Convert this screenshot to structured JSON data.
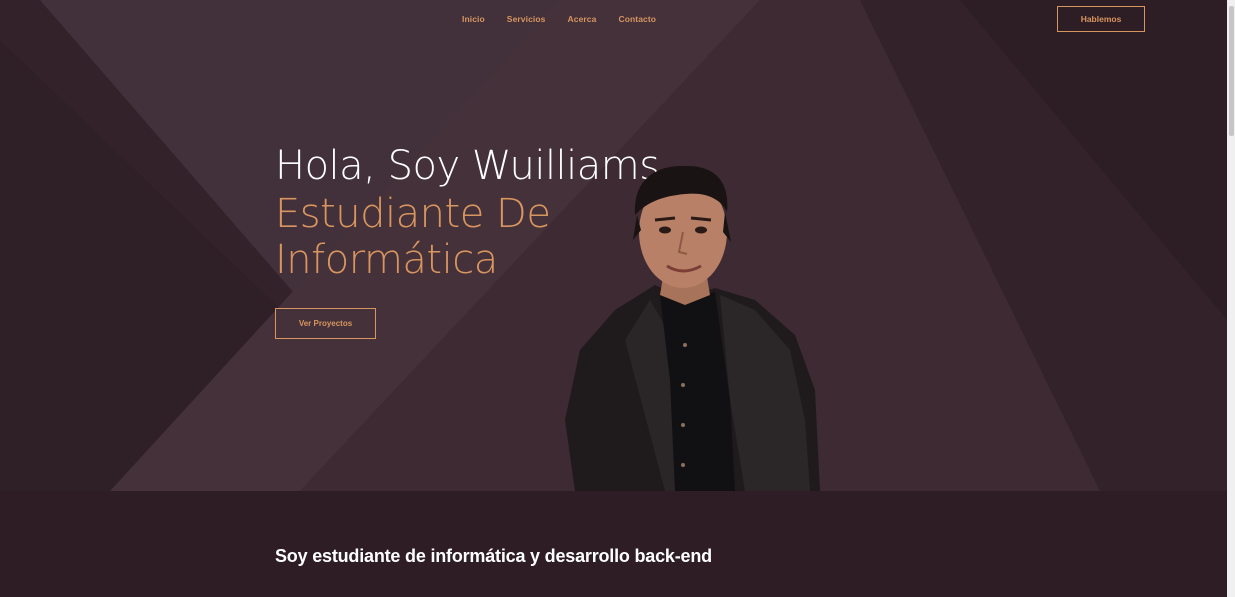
{
  "nav": {
    "items": [
      {
        "label": "Inicio"
      },
      {
        "label": "Servicios"
      },
      {
        "label": "Acerca"
      },
      {
        "label": "Contacto"
      }
    ],
    "cta_label": "Hablemos"
  },
  "hero": {
    "greeting": "Hola, Soy Wuilliams",
    "role": "Estudiante De Informática",
    "button_label": "Ver Proyectos"
  },
  "about": {
    "heading": "Soy estudiante de informática y desarrollo back-end"
  },
  "colors": {
    "accent": "#d99560",
    "hero_bg": "#3a2730",
    "section_bg": "#2e1d25"
  }
}
